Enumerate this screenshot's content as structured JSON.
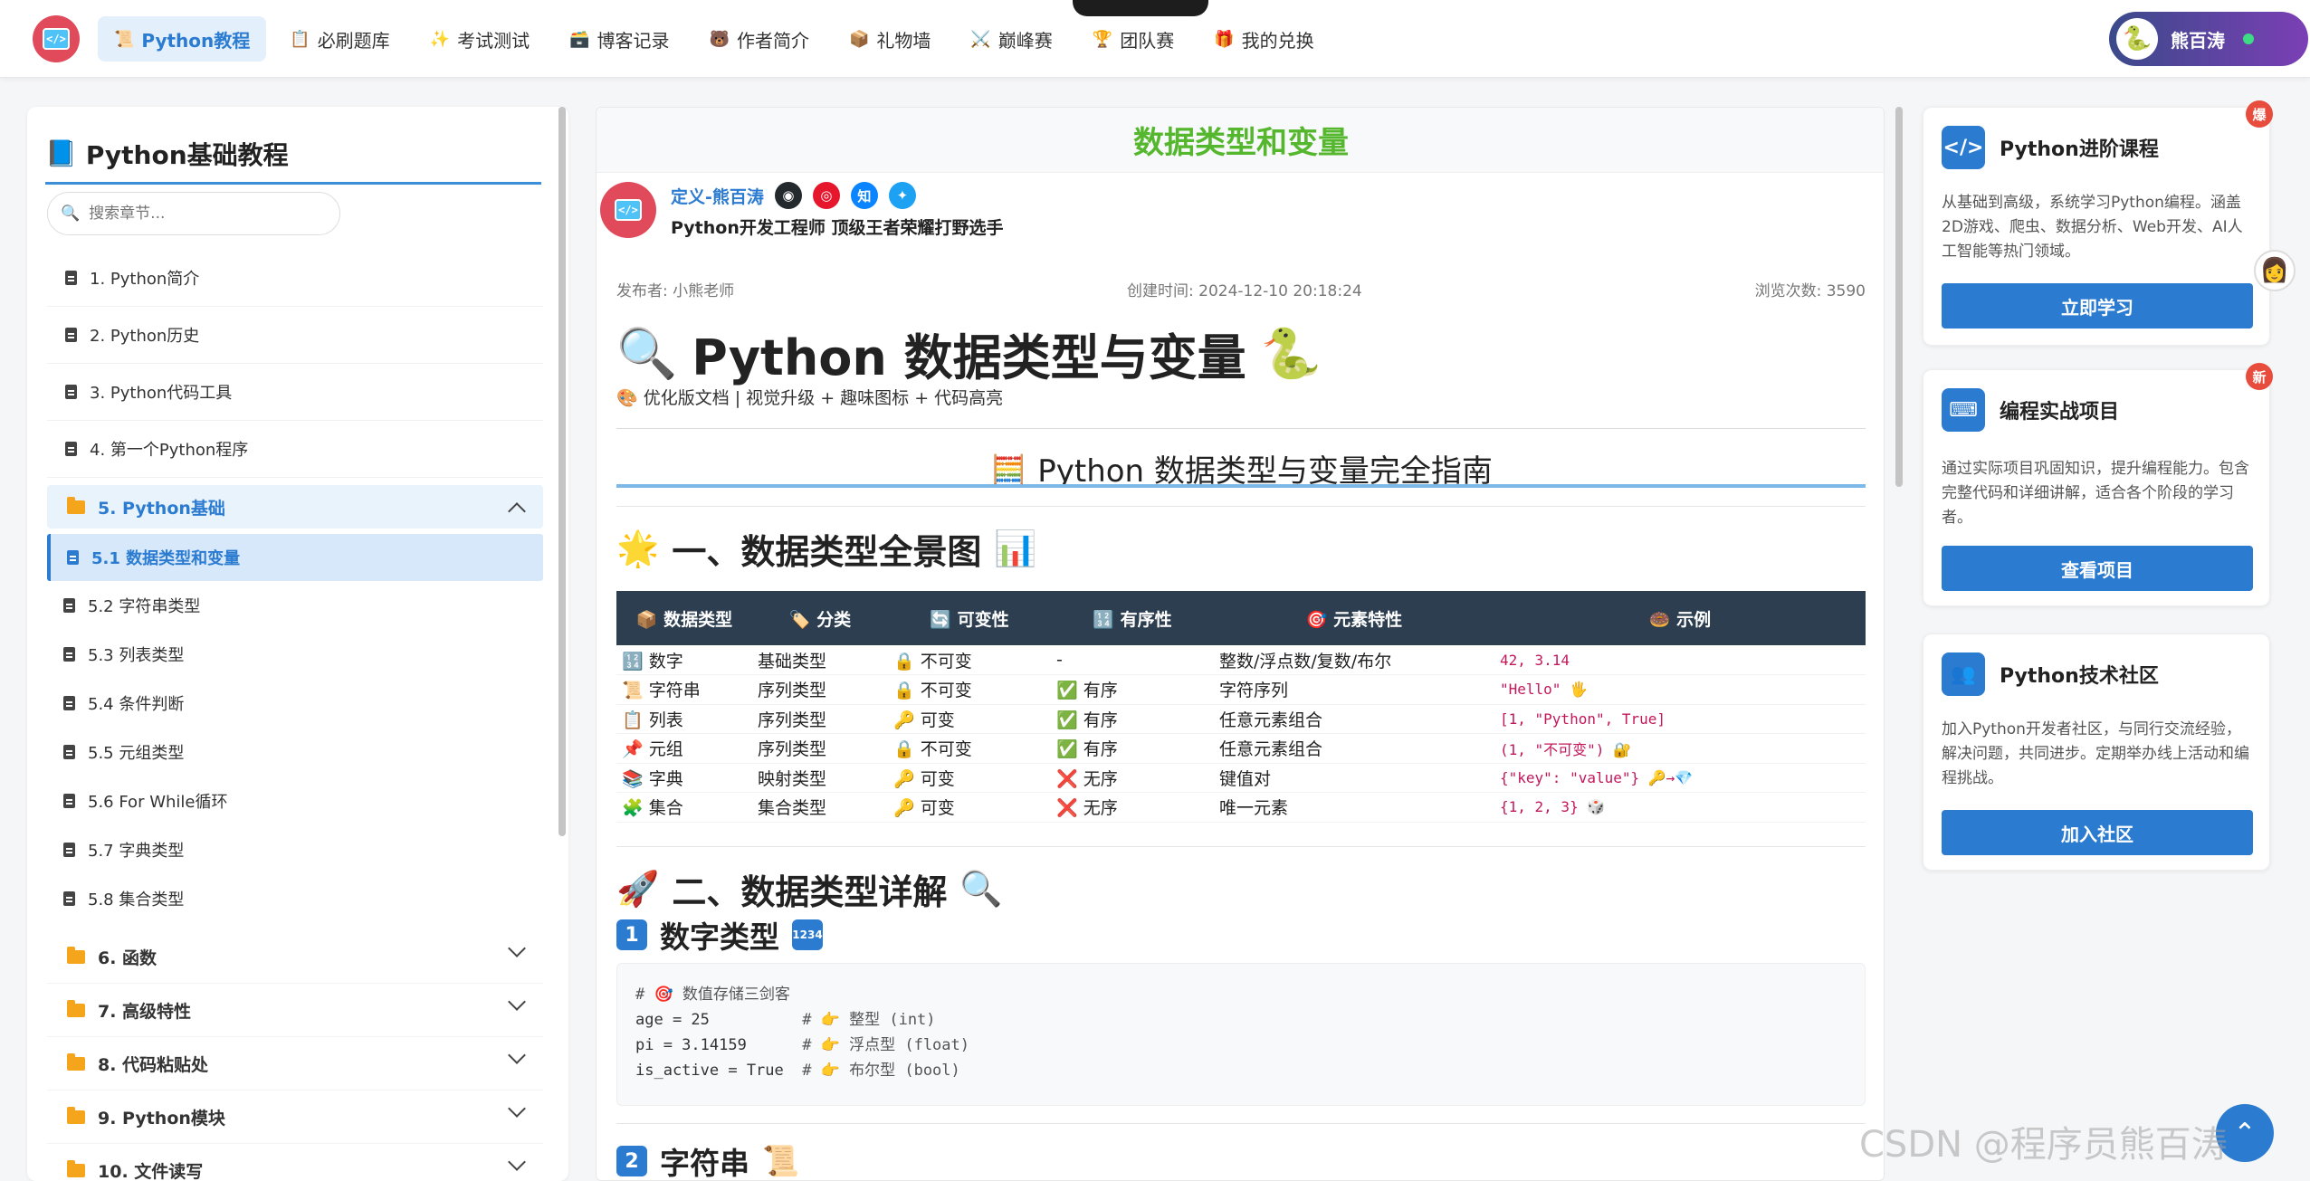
{
  "nav": {
    "items": [
      {
        "icon": "📜",
        "label": "Python教程",
        "active": true
      },
      {
        "icon": "📋",
        "label": "必刷题库"
      },
      {
        "icon": "✨",
        "label": "考试测试"
      },
      {
        "icon": "🗃️",
        "label": "博客记录"
      },
      {
        "icon": "🐻",
        "label": "作者简介"
      },
      {
        "icon": "📦",
        "label": "礼物墙"
      },
      {
        "icon": "⚔️",
        "label": "巅峰赛"
      },
      {
        "icon": "🏆",
        "label": "团队赛"
      },
      {
        "icon": "🎁",
        "label": "我的兑换"
      }
    ],
    "user_name": "熊百涛"
  },
  "sidebar": {
    "title": "Python基础教程",
    "search_placeholder": "搜索章节...",
    "chapters": [
      "1. Python简介",
      "2. Python历史",
      "3. Python代码工具",
      "4. 第一个Python程序"
    ],
    "open_section": "5. Python基础",
    "active_sub": "5.1 数据类型和变量",
    "subs": [
      "5.2 字符串类型",
      "5.3 列表类型",
      "5.4 条件判断",
      "5.5 元组类型",
      "5.6 For While循环",
      "5.7 字典类型",
      "5.8 集合类型"
    ],
    "collapsed": [
      "6. 函数",
      "7. 高级特性",
      "8. 代码粘贴处",
      "9. Python模块",
      "10. 文件读写"
    ]
  },
  "article": {
    "header": "数据类型和变量",
    "author_name": "定义-熊百涛",
    "author_desc": "Python开发工程师 顶级王者荣耀打野选手",
    "publisher": "发布者: 小熊老师",
    "created": "创建时间: 2024-12-10 20:18:24",
    "views": "浏览次数: 3590",
    "title": "Python 数据类型与变量",
    "subtitle": "🎨 优化版文档 | 视觉升级 + 趣味图标 + 代码高亮",
    "guide_title": "🧮 Python 数据类型与变量完全指南",
    "section1": "一、数据类型全景图",
    "table_headers": [
      "📦 数据类型",
      "🏷️ 分类",
      "🔄 可变性",
      "🔢 有序性",
      "🎯 元素特性",
      "🍩 示例"
    ],
    "table_rows": [
      [
        "🔢 数字",
        "基础类型",
        "🔒 不可变",
        "-",
        "整数/浮点数/复数/布尔",
        "42, 3.14"
      ],
      [
        "📜 字符串",
        "序列类型",
        "🔒 不可变",
        "✅ 有序",
        "字符序列",
        "\"Hello\" 🖐"
      ],
      [
        "📋 列表",
        "序列类型",
        "🔑 可变",
        "✅ 有序",
        "任意元素组合",
        "[1, \"Python\", True]"
      ],
      [
        "📌 元组",
        "序列类型",
        "🔒 不可变",
        "✅ 有序",
        "任意元素组合",
        "(1, \"不可变\") 🔐"
      ],
      [
        "📚 字典",
        "映射类型",
        "🔑 可变",
        "❌ 无序",
        "键值对",
        "{\"key\": \"value\"} 🔑→💎"
      ],
      [
        "🧩 集合",
        "集合类型",
        "🔑 可变",
        "❌ 无序",
        "唯一元素",
        "{1, 2, 3} 🎲"
      ]
    ],
    "section2": "二、数据类型详解",
    "sub1_num": "1",
    "sub1": "数字类型",
    "code_lines": [
      {
        "code": "# 🎯 数值存储三剑客",
        "comment": ""
      },
      {
        "code": "age = 25",
        "comment": "# 👉 整型 (int)"
      },
      {
        "code": "pi = 3.14159",
        "comment": "# 👉 浮点型 (float)"
      },
      {
        "code": "is_active = True",
        "comment": "# 👉 布尔型 (bool)"
      }
    ],
    "sub2_num": "2",
    "sub2": "字符串"
  },
  "cards": [
    {
      "title": "Python进阶课程",
      "desc": "从基础到高级，系统学习Python编程。涵盖2D游戏、爬虫、数据分析、Web开发、AI人工智能等热门领域。",
      "button": "立即学习",
      "badge": "爆",
      "icon": "</>"
    },
    {
      "title": "编程实战项目",
      "desc": "通过实际项目巩固知识，提升编程能力。包含完整代码和详细讲解，适合各个阶段的学习者。",
      "button": "查看项目",
      "badge": "新",
      "icon": "⌨"
    },
    {
      "title": "Python技术社区",
      "desc": "加入Python开发者社区，与同行交流经验，解决问题，共同进步。定期举办线上活动和编程挑战。",
      "button": "加入社区",
      "badge": "",
      "icon": "👥"
    }
  ],
  "watermark": "CSDN @程序员熊百涛",
  "colors": {
    "accent": "#2b7bd1",
    "header_green": "#55b72d",
    "table_head": "#2c3e50"
  }
}
